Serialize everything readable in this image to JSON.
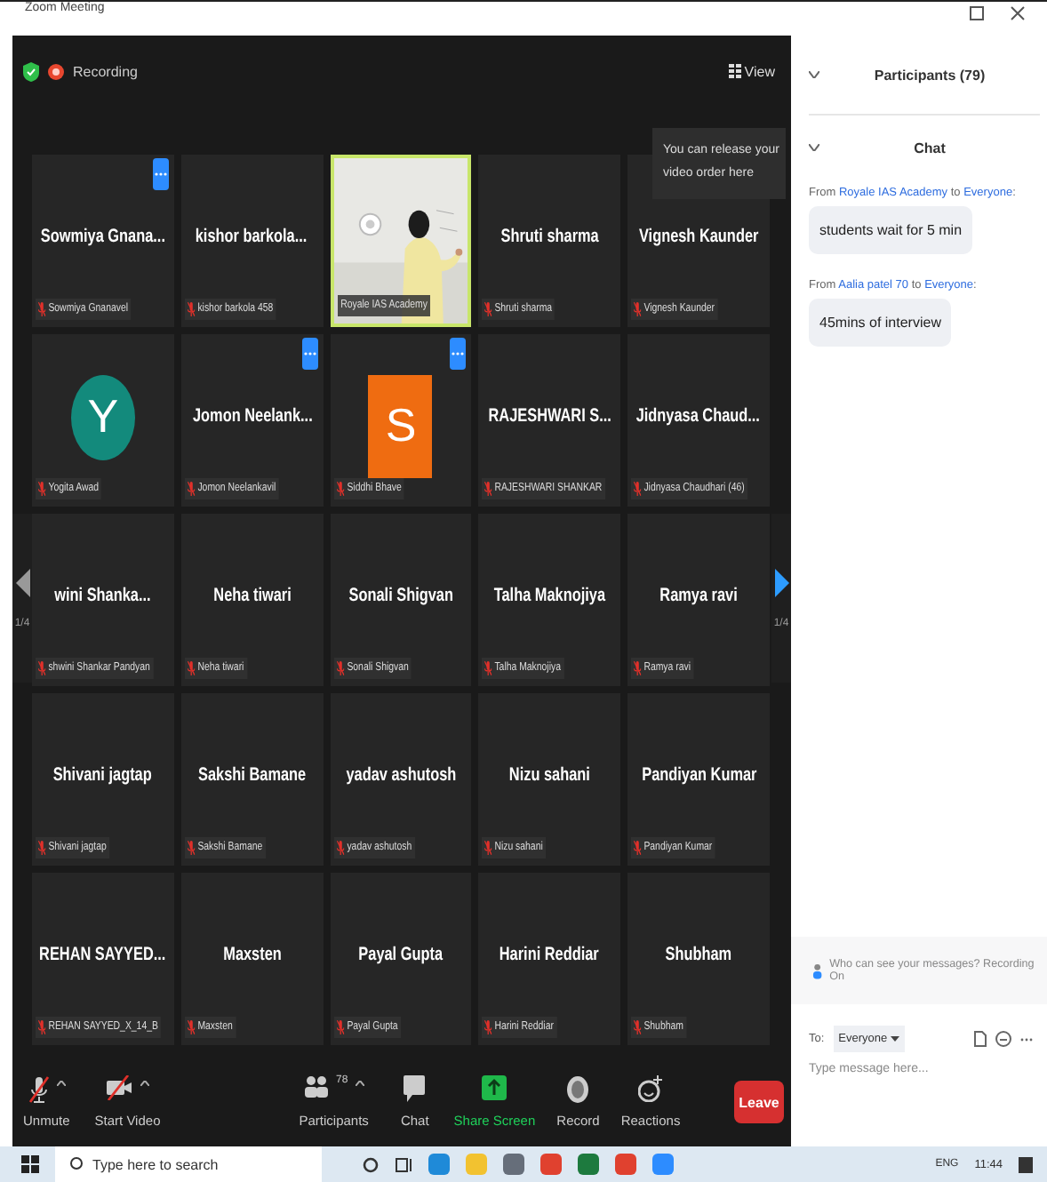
{
  "window": {
    "title": "Zoom Meeting"
  },
  "top_bar": {
    "recording_label": "Recording",
    "view_label": "View",
    "tooltip": "You can release your video order here"
  },
  "grid": {
    "tiles": [
      {
        "kind": "name",
        "name": "Sowmiya  Gnana...",
        "label": "Sowmiya Gnanavel",
        "muted": true,
        "speaking": false,
        "menu_button": true
      },
      {
        "kind": "name",
        "name": "kishor barkola...",
        "label": "kishor barkola 458",
        "muted": true,
        "speaking": false,
        "menu_button": false
      },
      {
        "kind": "video",
        "label": "Royale IAS Academy",
        "muted": false,
        "speaking": true,
        "menu_button": false
      },
      {
        "kind": "name",
        "name": "Shruti sharma",
        "label": "Shruti sharma",
        "muted": true,
        "speaking": false,
        "menu_button": false
      },
      {
        "kind": "name",
        "name": "Vignesh Kaunder",
        "label": "Vignesh Kaunder",
        "muted": true,
        "speaking": false,
        "menu_button": false
      },
      {
        "kind": "round_avatar",
        "initial": "Y",
        "color": "#138a7c",
        "label": "Yogita Awad",
        "muted": true,
        "speaking": false,
        "menu_button": false
      },
      {
        "kind": "name",
        "name": "Jomon  Neelank...",
        "label": "Jomon Neelankavil",
        "muted": true,
        "speaking": false,
        "menu_button": true
      },
      {
        "kind": "square_avatar",
        "initial": "S",
        "color": "#ef6c11",
        "label": "Siddhi Bhave",
        "muted": true,
        "speaking": false,
        "menu_button": true
      },
      {
        "kind": "name",
        "name": "RAJESHWARI  S...",
        "label": "RAJESHWARI SHANKAR",
        "muted": true,
        "speaking": false,
        "menu_button": false
      },
      {
        "kind": "name",
        "name": "Jidnyasa  Chaud...",
        "label": "Jidnyasa Chaudhari (46)",
        "muted": true,
        "speaking": false,
        "menu_button": false
      },
      {
        "kind": "name",
        "name": "wini  Shanka...",
        "label": "shwini Shankar Pandyan",
        "muted": true,
        "speaking": false,
        "menu_button": false
      },
      {
        "kind": "name",
        "name": "Neha tiwari",
        "label": "Neha tiwari",
        "muted": true,
        "speaking": false,
        "menu_button": false
      },
      {
        "kind": "name",
        "name": "Sonali Shigvan",
        "label": "Sonali Shigvan",
        "muted": true,
        "speaking": false,
        "menu_button": false
      },
      {
        "kind": "name",
        "name": "Talha Maknojiya",
        "label": "Talha Maknojiya",
        "muted": true,
        "speaking": false,
        "menu_button": false
      },
      {
        "kind": "name",
        "name": "Ramya ravi",
        "label": "Ramya ravi",
        "muted": true,
        "speaking": false,
        "menu_button": false
      },
      {
        "kind": "name",
        "name": "Shivani jagtap",
        "label": "Shivani jagtap",
        "muted": true,
        "speaking": false,
        "menu_button": false
      },
      {
        "kind": "name",
        "name": "Sakshi Bamane",
        "label": "Sakshi Bamane",
        "muted": true,
        "speaking": false,
        "menu_button": false
      },
      {
        "kind": "name",
        "name": "yadav ashutosh",
        "label": "yadav ashutosh",
        "muted": true,
        "speaking": false,
        "menu_button": false
      },
      {
        "kind": "name",
        "name": "Nizu sahani",
        "label": "Nizu sahani",
        "muted": true,
        "speaking": false,
        "menu_button": false
      },
      {
        "kind": "name",
        "name": "Pandiyan Kumar",
        "label": "Pandiyan Kumar",
        "muted": true,
        "speaking": false,
        "menu_button": false
      },
      {
        "kind": "name",
        "name": "REHAN  SAYYED...",
        "label": "REHAN SAYYED_X_14_B",
        "muted": true,
        "speaking": false,
        "menu_button": false
      },
      {
        "kind": "name",
        "name": "Maxsten",
        "label": "Maxsten",
        "muted": true,
        "speaking": false,
        "menu_button": false
      },
      {
        "kind": "name",
        "name": "Payal Gupta",
        "label": "Payal Gupta",
        "muted": true,
        "speaking": false,
        "menu_button": false
      },
      {
        "kind": "name",
        "name": "Harini Reddiar",
        "label": "Harini Reddiar",
        "muted": true,
        "speaking": false,
        "menu_button": false
      },
      {
        "kind": "name",
        "name": "Shubham",
        "label": "Shubham",
        "muted": true,
        "speaking": false,
        "menu_button": false
      }
    ],
    "pager": {
      "left": {
        "label": "1/4",
        "disabled": true
      },
      "right": {
        "label": "1/4",
        "disabled": false
      }
    }
  },
  "toolbar": {
    "controls": [
      {
        "kind": "mic",
        "label": "Unmute",
        "caret": true
      },
      {
        "kind": "video",
        "label": "Start Video",
        "caret": true
      },
      {
        "kind": "participants",
        "label": "Participants",
        "count": "78",
        "caret": true
      },
      {
        "kind": "chat",
        "label": "Chat",
        "caret": false
      },
      {
        "kind": "share",
        "label": "Share Screen",
        "caret": false
      },
      {
        "kind": "record",
        "label": "Record",
        "caret": false
      },
      {
        "kind": "reactions",
        "label": "Reactions",
        "caret": false
      }
    ],
    "leave": "Leave"
  },
  "panel": {
    "participants_header": "Participants (79)",
    "participants_expanded": false,
    "chat_header": "Chat",
    "messages": [
      {
        "from": "From",
        "sender": "Royale IAS Academy",
        "to": "to",
        "recipient": "Everyone",
        "end": ":",
        "text": "students wait for 5 min"
      },
      {
        "from": "From",
        "sender": "Aalia patel 70",
        "to": "to",
        "recipient": "Everyone",
        "end": ":",
        "text": "45mins of interview"
      }
    ],
    "notice": "Who can see your messages? Recording On",
    "to_label": "To:",
    "recipient": "Everyone",
    "placeholder": "Type message here..."
  },
  "taskbar": {
    "search_placeholder": "Type here to search",
    "language": "ENG",
    "time": "11:44"
  }
}
